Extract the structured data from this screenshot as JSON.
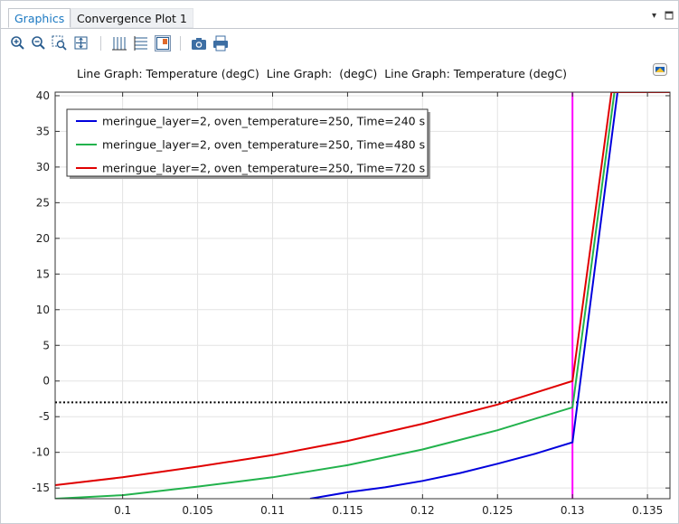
{
  "tabs": [
    {
      "label": "Graphics",
      "active": true
    },
    {
      "label": "Convergence Plot 1",
      "active": false
    }
  ],
  "tab_controls": {
    "menu_glyph": "▾",
    "dock_glyph": "▫"
  },
  "toolbar": {
    "icons": [
      "zoom-in-icon",
      "zoom-out-icon",
      "zoom-box-icon",
      "zoom-extents-icon",
      "x-grid-icon",
      "y-grid-icon",
      "legend-toggle-icon",
      "camera-icon",
      "print-icon"
    ]
  },
  "plot_title": "Line Graph: Temperature (degC)  Line Graph:  (degC)  Line Graph: Temperature (degC)",
  "colors": {
    "blue": "#0000dd",
    "green": "#22b24c",
    "red": "#e00000",
    "magenta": "#ff00ff",
    "accent": "#1a78c2"
  },
  "chart_data": {
    "type": "line",
    "title": "Line Graph: Temperature (degC)  Line Graph:  (degC)  Line Graph: Temperature (degC)",
    "xlabel": "",
    "ylabel": "",
    "xlim": [
      0.0955,
      0.1365
    ],
    "ylim": [
      -16.5,
      40.5
    ],
    "x_ticks": [
      {
        "v": 0.1,
        "label": "0.1"
      },
      {
        "v": 0.105,
        "label": "0.105"
      },
      {
        "v": 0.11,
        "label": "0.11"
      },
      {
        "v": 0.115,
        "label": "0.115"
      },
      {
        "v": 0.12,
        "label": "0.12"
      },
      {
        "v": 0.125,
        "label": "0.125"
      },
      {
        "v": 0.13,
        "label": "0.13"
      },
      {
        "v": 0.135,
        "label": "0.135"
      }
    ],
    "y_ticks": [
      {
        "v": -15,
        "label": "-15"
      },
      {
        "v": -10,
        "label": "-10"
      },
      {
        "v": -5,
        "label": "-5"
      },
      {
        "v": 0,
        "label": "0"
      },
      {
        "v": 5,
        "label": "5"
      },
      {
        "v": 10,
        "label": "10"
      },
      {
        "v": 15,
        "label": "15"
      },
      {
        "v": 20,
        "label": "20"
      },
      {
        "v": 25,
        "label": "25"
      },
      {
        "v": 30,
        "label": "30"
      },
      {
        "v": 35,
        "label": "35"
      },
      {
        "v": 40,
        "label": "40"
      }
    ],
    "grid": true,
    "legend_position": "top-left",
    "series": [
      {
        "name": "meringue_layer=2, oven_temperature=250, Time=240 s",
        "color": "#0000dd",
        "x": [
          0.1125,
          0.115,
          0.1175,
          0.12,
          0.1225,
          0.125,
          0.1275,
          0.13,
          0.133,
          0.1365
        ],
        "y": [
          -16.5,
          -15.6,
          -14.9,
          -14.0,
          -12.9,
          -11.6,
          -10.2,
          -8.6,
          40.5,
          40.5
        ]
      },
      {
        "name": "meringue_layer=2, oven_temperature=250, Time=480 s",
        "color": "#22b24c",
        "x": [
          0.0955,
          0.1,
          0.105,
          0.11,
          0.115,
          0.12,
          0.125,
          0.13,
          0.1328,
          0.1365
        ],
        "y": [
          -16.5,
          -16.0,
          -14.8,
          -13.5,
          -11.8,
          -9.6,
          -6.9,
          -3.7,
          40.5,
          40.5
        ]
      },
      {
        "name": "meringue_layer=2, oven_temperature=250, Time=720 s",
        "color": "#e00000",
        "x": [
          0.0955,
          0.1,
          0.105,
          0.11,
          0.115,
          0.12,
          0.125,
          0.13,
          0.1326,
          0.1365
        ],
        "y": [
          -14.6,
          -13.5,
          -12.0,
          -10.4,
          -8.4,
          -6.0,
          -3.3,
          0.0,
          40.5,
          40.5
        ]
      }
    ],
    "reference_lines": [
      {
        "orientation": "vertical",
        "x": 0.13,
        "color": "#ff00ff",
        "style": "solid"
      },
      {
        "orientation": "horizontal",
        "y": -3.0,
        "color": "#000000",
        "style": "dotted"
      }
    ]
  }
}
